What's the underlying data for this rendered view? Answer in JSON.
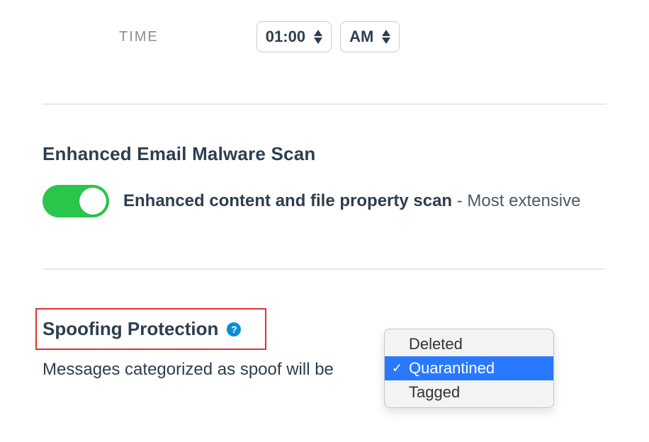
{
  "time": {
    "label": "TIME",
    "hour_value": "01:00",
    "meridiem_value": "AM"
  },
  "malware_section": {
    "title": "Enhanced Email Malware Scan",
    "toggle_on": true,
    "toggle_bold_text": "Enhanced content and file property scan",
    "toggle_light_text": " - Most extensive "
  },
  "spoof_section": {
    "title": "Spoofing Protection",
    "description": "Messages categorized as spoof will be",
    "help_glyph": "?"
  },
  "dropdown": {
    "options": [
      "Deleted",
      "Quarantined",
      "Tagged"
    ],
    "selected": "Quarantined",
    "check_glyph": "✓"
  }
}
